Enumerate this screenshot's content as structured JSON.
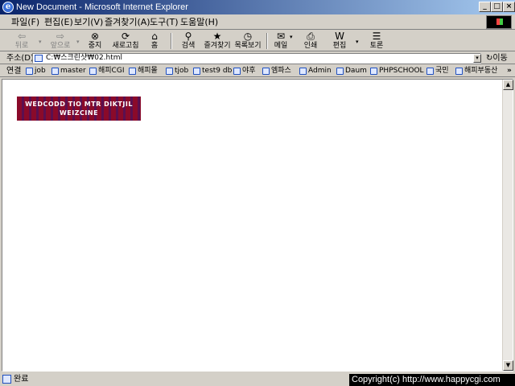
{
  "window": {
    "title": "New Document - Microsoft Internet Explorer",
    "controls": {
      "minimize": "_",
      "maximize": "□",
      "close": "×"
    }
  },
  "menu": {
    "items": [
      "파일(F)",
      "편집(E)",
      "보기(V)",
      "즐겨찾기(A)",
      "도구(T)",
      "도움말(H)"
    ]
  },
  "toolbar": {
    "buttons": [
      {
        "label": "뒤로",
        "icon": "back-arrow-icon",
        "glyph": "⇦",
        "enabled": false
      },
      {
        "label": "앞으로",
        "icon": "forward-arrow-icon",
        "glyph": "⇨",
        "enabled": false
      },
      {
        "label": "중지",
        "icon": "stop-icon",
        "glyph": "⊗",
        "enabled": true
      },
      {
        "label": "새로고침",
        "icon": "refresh-icon",
        "glyph": "⟳",
        "enabled": true
      },
      {
        "label": "홈",
        "icon": "home-icon",
        "glyph": "⌂",
        "enabled": true
      },
      {
        "label": "검색",
        "icon": "search-icon",
        "glyph": "⚲",
        "enabled": true
      },
      {
        "label": "즐겨찾기",
        "icon": "favorites-icon",
        "glyph": "★",
        "enabled": true
      },
      {
        "label": "목록보기",
        "icon": "history-icon",
        "glyph": "◷",
        "enabled": true
      },
      {
        "label": "메일",
        "icon": "mail-icon",
        "glyph": "✉",
        "enabled": true
      },
      {
        "label": "인쇄",
        "icon": "print-icon",
        "glyph": "⎙",
        "enabled": true
      },
      {
        "label": "편집",
        "icon": "edit-icon",
        "glyph": "W",
        "enabled": true
      },
      {
        "label": "토론",
        "icon": "discuss-icon",
        "glyph": "☰",
        "enabled": true
      }
    ],
    "dropdown_glyph": "▾"
  },
  "address": {
    "label": "주소(D)",
    "value": "C:₩스크린샷₩02.html",
    "go_label": "↻이동"
  },
  "links": {
    "label": "연결",
    "items": [
      "job",
      "master",
      "해피CGI",
      "해피몰",
      "tjob",
      "test9 db",
      "야후",
      "엠파스",
      "Admin",
      "Daum",
      "PHPSCHOOL",
      "국민",
      "해피부동산"
    ],
    "more": "»"
  },
  "content": {
    "banner": {
      "line1": "WEDCODD TIO MTR DIKTJIL",
      "line2": "WEIZCINE",
      "colors": {
        "primary": "#8a0a2a",
        "secondary": "#5a1050"
      }
    }
  },
  "scrollbar": {
    "up": "▲",
    "down": "▼"
  },
  "status": {
    "text": "완료",
    "copyright": "Copyright(c) http://www.happycgi.com"
  }
}
